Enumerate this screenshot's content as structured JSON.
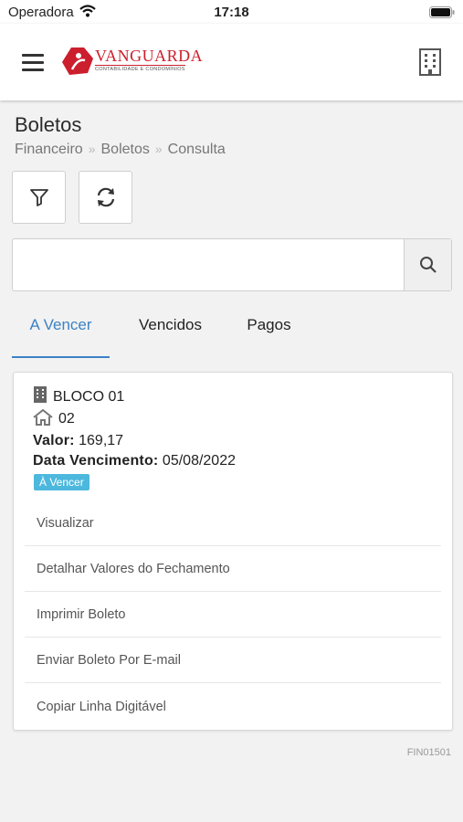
{
  "status_bar": {
    "carrier": "Operadora",
    "time": "17:18"
  },
  "header": {
    "logo": {
      "name": "VANGUARDA",
      "subtitle": "CONTABILIDADE E CONDOMÍNIOS",
      "brand_color": "#cc1f2d"
    },
    "menu_icon": "hamburger-icon",
    "building_icon": "building-icon"
  },
  "page": {
    "title": "Boletos",
    "breadcrumb": [
      "Financeiro",
      "Boletos",
      "Consulta"
    ],
    "code": "FIN01501"
  },
  "toolbar": {
    "filter_icon": "filter-icon",
    "refresh_icon": "refresh-icon"
  },
  "search": {
    "value": "",
    "placeholder": "",
    "icon": "search-icon"
  },
  "tabs": [
    {
      "label": "A Vencer",
      "active": true
    },
    {
      "label": "Vencidos",
      "active": false
    },
    {
      "label": "Pagos",
      "active": false
    }
  ],
  "accent_color": "#3b82c4",
  "card": {
    "block": "BLOCO 01",
    "unit": "02",
    "valor_label": "Valor:",
    "valor": "169,17",
    "vencimento_label": "Data Vencimento:",
    "vencimento": "05/08/2022",
    "status": "À Vencer",
    "status_color": "#4db8dd",
    "actions": [
      "Visualizar",
      "Detalhar Valores do Fechamento",
      "Imprimir Boleto",
      "Enviar Boleto Por E-mail",
      "Copiar Linha Digitável"
    ]
  }
}
